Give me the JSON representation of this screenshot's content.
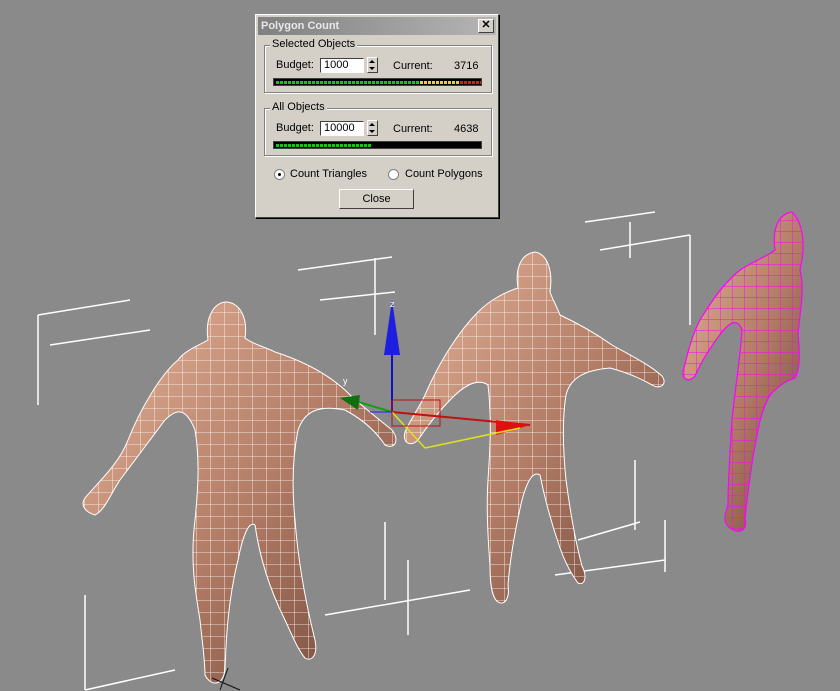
{
  "dialog": {
    "title": "Polygon Count",
    "close_glyph": "✕",
    "selected": {
      "group_title": "Selected Objects",
      "budget_label": "Budget:",
      "budget_value": "1000",
      "current_label": "Current:",
      "current_value": "3716",
      "meter_segments": {
        "green": 36,
        "yellow": 10,
        "red": 8
      }
    },
    "all": {
      "group_title": "All Objects",
      "budget_label": "Budget:",
      "budget_value": "10000",
      "current_label": "Current:",
      "current_value": "4638",
      "meter_segments": {
        "green": 24,
        "yellow": 0,
        "red": 0
      }
    },
    "radio_triangles": "Count Triangles",
    "radio_polygons": "Count Polygons",
    "radio_selected": "triangles",
    "close_button": "Close"
  },
  "viewport": {
    "background": "#8a8a8a",
    "skin_color": "#c49078",
    "wire_white": "#ffffff",
    "wire_selected": "#ff00ff",
    "gizmo": {
      "z_label": "z",
      "y_label": "y"
    }
  },
  "colors": {
    "meter_green": "#19c419",
    "meter_yellow": "#e8d23c",
    "meter_red": "#d11d1d"
  }
}
